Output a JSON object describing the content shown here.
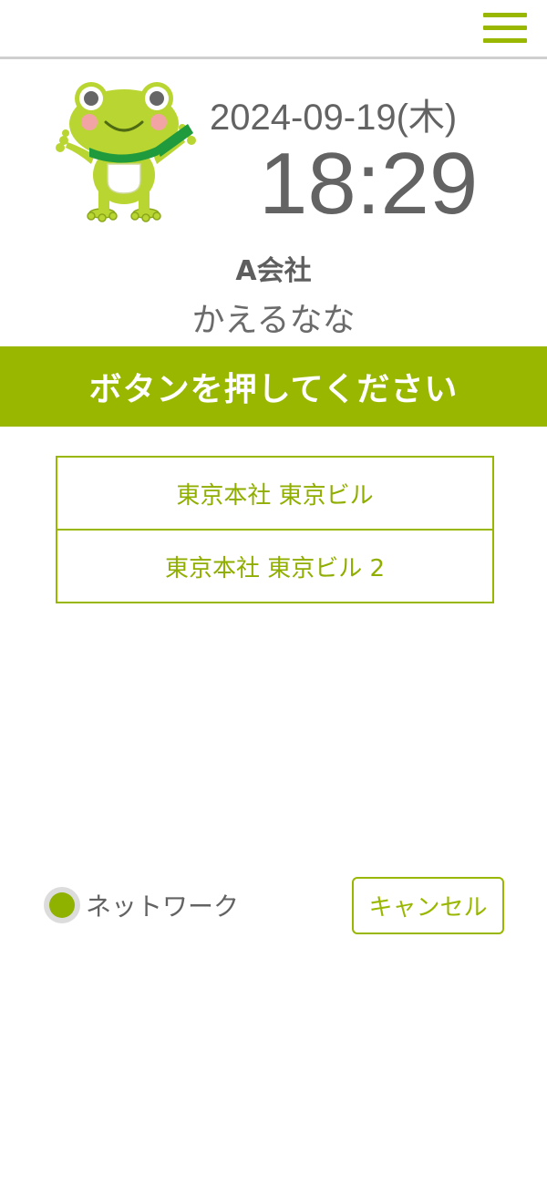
{
  "header": {
    "menu_icon": "hamburger-menu-icon"
  },
  "mascot": {
    "icon": "frog-mascot-icon"
  },
  "clock": {
    "date": "2024-09-19(木)",
    "time": "18:29"
  },
  "user": {
    "company": "A会社",
    "name": "かえるなな"
  },
  "banner": {
    "text": "ボタンを押してください"
  },
  "locations": [
    {
      "label": "東京本社 東京ビル"
    },
    {
      "label": "東京本社 東京ビル 2"
    }
  ],
  "footer": {
    "network_label": "ネットワーク",
    "cancel_label": "キャンセル"
  },
  "colors": {
    "accent": "#9ab700",
    "text": "#636363",
    "status_ok": "#8fb100"
  }
}
